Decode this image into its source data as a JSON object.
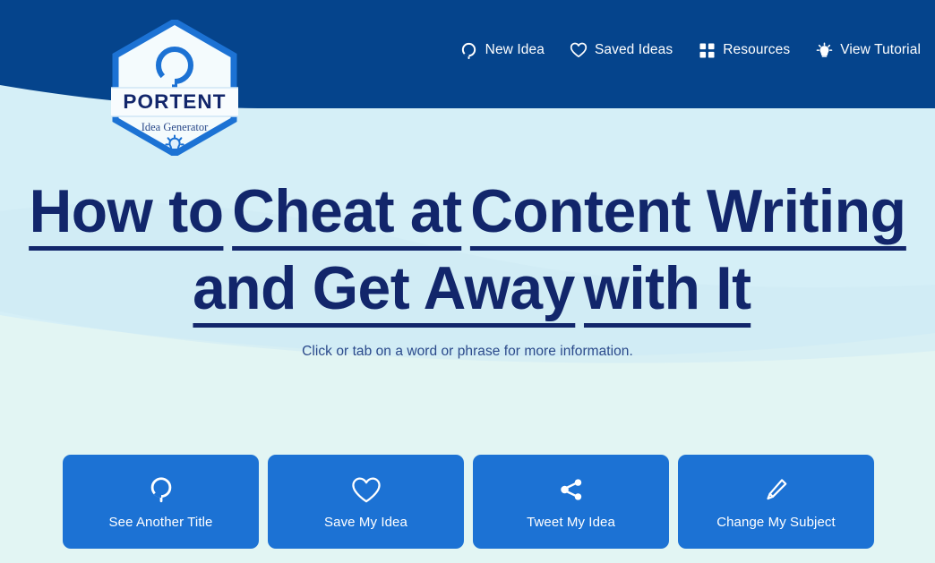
{
  "brand": {
    "name": "PORTENT",
    "tagline": "Idea Generator",
    "badge_icon": "portent-loop-icon",
    "bulb_icon": "lightbulb-icon"
  },
  "nav": {
    "items": [
      {
        "label": "New Idea",
        "icon": "new-idea-loop-icon"
      },
      {
        "label": "Saved Ideas",
        "icon": "heart-icon"
      },
      {
        "label": "Resources",
        "icon": "grid-squares-icon"
      },
      {
        "label": "View Tutorial",
        "icon": "lightbulb-icon"
      }
    ]
  },
  "main": {
    "headline_phrases": [
      "How to",
      "Cheat at",
      "Content Writing",
      "and Get Away",
      "with It"
    ],
    "headline_full": "How to Cheat at Content Writing and Get Away with It",
    "subtitle": "Click or tab on a word or phrase for more information."
  },
  "actions": [
    {
      "label": "See Another Title",
      "icon": "refresh-loop-icon"
    },
    {
      "label": "Save My Idea",
      "icon": "heart-icon"
    },
    {
      "label": "Tweet My Idea",
      "icon": "share-icon"
    },
    {
      "label": "Change My Subject",
      "icon": "pencil-icon"
    }
  ],
  "colors": {
    "header_navy": "#05448C",
    "headline_navy": "#12266B",
    "button_blue": "#1C72D4",
    "bg_mint": "#E2F5F3",
    "bg_cyan": "#D5EFF7",
    "logo_blue": "#1C72D4"
  }
}
